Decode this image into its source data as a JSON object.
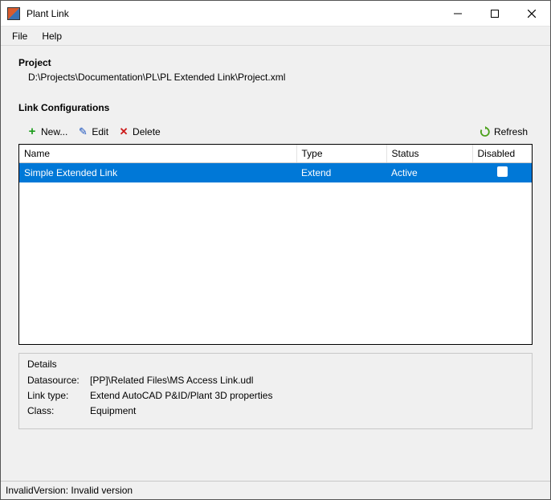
{
  "window": {
    "title": "Plant Link"
  },
  "menu": {
    "file": "File",
    "help": "Help"
  },
  "project": {
    "label": "Project",
    "path": "D:\\Projects\\Documentation\\PL\\PL Extended Link\\Project.xml"
  },
  "section": {
    "title": "Link Configurations"
  },
  "toolbar": {
    "new": "New...",
    "edit": "Edit",
    "delete": "Delete",
    "refresh": "Refresh"
  },
  "table": {
    "headers": {
      "name": "Name",
      "type": "Type",
      "status": "Status",
      "disabled": "Disabled"
    },
    "rows": [
      {
        "name": "Simple Extended Link",
        "type": "Extend",
        "status": "Active",
        "disabled": false
      }
    ]
  },
  "details": {
    "title": "Details",
    "datasource_label": "Datasource:",
    "datasource": "[PP]\\Related Files\\MS Access Link.udl",
    "linktype_label": "Link type:",
    "linktype": "Extend AutoCAD P&ID/Plant 3D properties",
    "class_label": "Class:",
    "class": "Equipment"
  },
  "status": "InvalidVersion: Invalid version"
}
